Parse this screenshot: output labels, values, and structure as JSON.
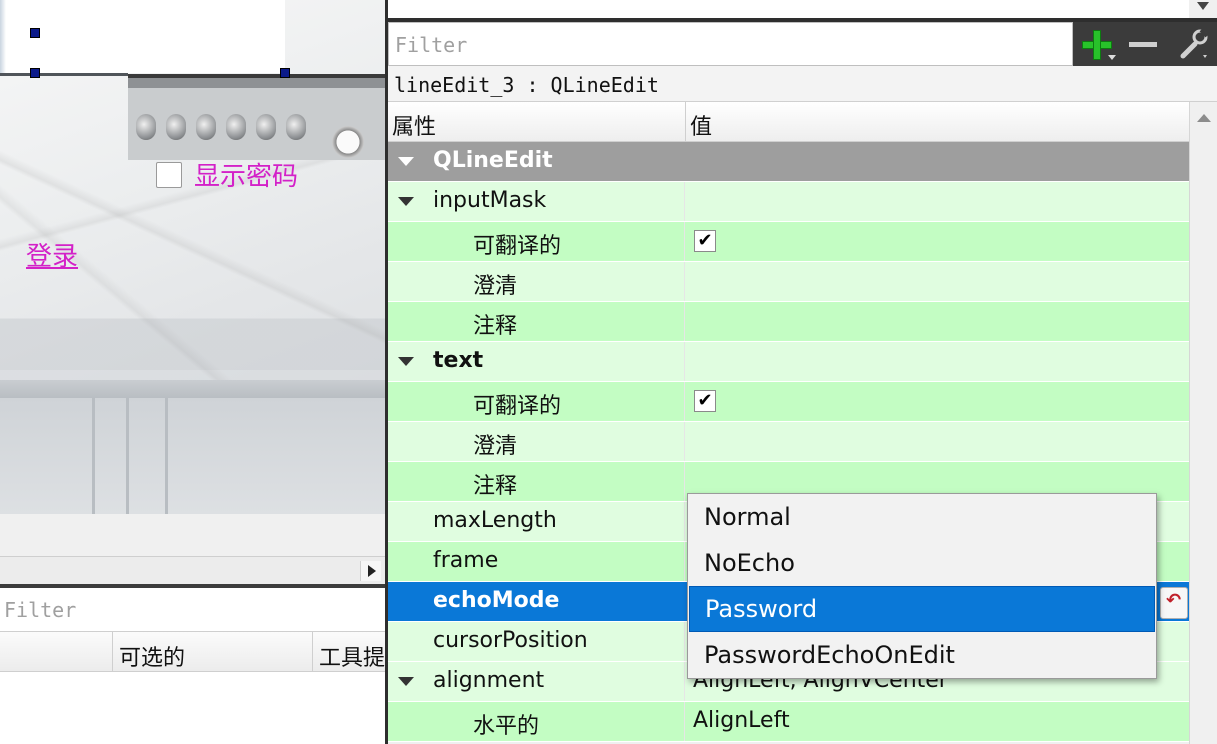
{
  "form_preview": {
    "checkbox_label": "显示密码",
    "login_link": "登录"
  },
  "action_editor": {
    "filter_placeholder": "Filter",
    "columns": [
      "",
      "可选的",
      "工具提"
    ]
  },
  "property_editor": {
    "filter_placeholder": "Filter",
    "object_line": "lineEdit_3 : QLineEdit",
    "headers": {
      "property": "属性",
      "value": "值"
    },
    "rows": [
      {
        "name": "QLineEdit",
        "value": ""
      },
      {
        "name": "inputMask",
        "value": ""
      },
      {
        "name": "可翻译的",
        "value": ""
      },
      {
        "name": "澄清",
        "value": ""
      },
      {
        "name": "注释",
        "value": ""
      },
      {
        "name": "text",
        "value": ""
      },
      {
        "name": "可翻译的",
        "value": ""
      },
      {
        "name": "澄清",
        "value": ""
      },
      {
        "name": "注释",
        "value": ""
      },
      {
        "name": "maxLength",
        "value": ""
      },
      {
        "name": "frame",
        "value": ""
      },
      {
        "name": "echoMode",
        "value": ""
      },
      {
        "name": "cursorPosition",
        "value": ""
      },
      {
        "name": "alignment",
        "value": "AlignLeft, AlignVCenter"
      },
      {
        "name": "水平的",
        "value": "AlignLeft"
      }
    ],
    "checkbox_mark": "✔",
    "colors": {
      "selected": "#0a78d7",
      "category": "#9e9e9e",
      "row_light": "#e0fde0",
      "row_dark": "#c3fdc3"
    }
  },
  "dropdown": {
    "options": [
      "Normal",
      "NoEcho",
      "Password",
      "PasswordEchoOnEdit"
    ],
    "selected": "Password"
  },
  "icons": [
    "add-property-icon",
    "remove-property-icon",
    "configure-wrench-icon",
    "reset-property-icon"
  ]
}
